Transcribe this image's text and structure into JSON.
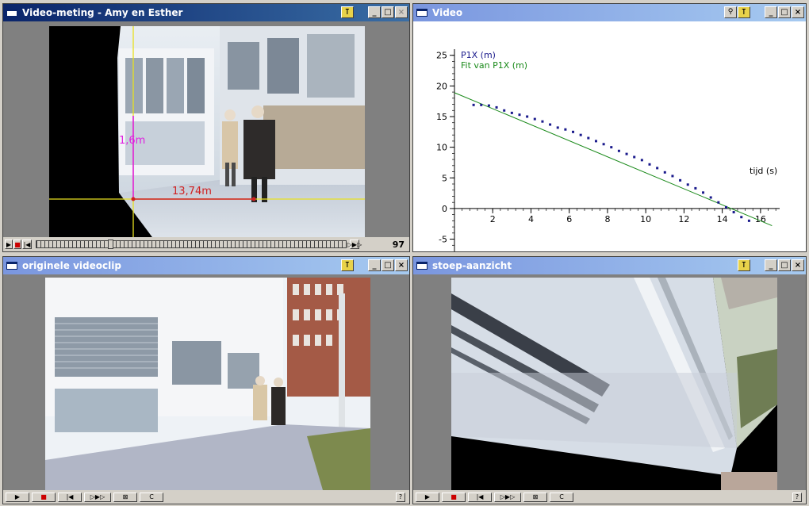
{
  "windows": {
    "measure": {
      "title": "Video-meting - Amy en Esther",
      "frame": "97",
      "label_height": "1,6m",
      "label_distance": "13,74m"
    },
    "graph": {
      "title": "Video"
    },
    "original": {
      "title": "originele videoclip"
    },
    "sidewalk": {
      "title": "stoep-aanzicht"
    }
  },
  "title_buttons": {
    "minimize": "_",
    "maximize": "□",
    "close": "×",
    "pin": "⊺",
    "zoom": "🔍"
  },
  "playback": {
    "play": "▶",
    "stop": "■",
    "first": "|◀",
    "step": "▷▶▷",
    "mark": "⊠",
    "loop": "C",
    "help": "?"
  },
  "colors": {
    "accent_title": "#0a246a",
    "series_points": "#1a1a8c",
    "fit_line": "#1a8a1a",
    "measure_magenta": "#e020e0",
    "measure_red": "#d02020",
    "axis_yellow": "#e8e020"
  },
  "chart_data": {
    "type": "scatter",
    "xlabel": "tijd (s)",
    "ylabel": "",
    "xlim": [
      0,
      17
    ],
    "ylim": [
      -7,
      26
    ],
    "x_ticks": [
      2,
      4,
      6,
      8,
      10,
      12,
      14,
      16
    ],
    "y_ticks": [
      -5,
      0,
      5,
      10,
      15,
      20,
      25
    ],
    "legend_position": "top-left",
    "series": [
      {
        "name": "P1X (m)",
        "color": "#1a1a8c",
        "x": [
          1.0,
          1.4,
          1.8,
          2.2,
          2.6,
          3.0,
          3.4,
          3.8,
          4.2,
          4.6,
          5.0,
          5.4,
          5.8,
          6.2,
          6.6,
          7.0,
          7.4,
          7.8,
          8.2,
          8.6,
          9.0,
          9.4,
          9.8,
          10.2,
          10.6,
          11.0,
          11.4,
          11.8,
          12.2,
          12.6,
          13.0,
          13.4,
          13.8,
          14.2,
          14.6,
          15.0,
          15.4
        ],
        "y": [
          16.9,
          16.9,
          16.8,
          16.5,
          16.0,
          15.6,
          15.3,
          15.0,
          14.6,
          14.2,
          13.7,
          13.2,
          12.9,
          12.5,
          12.0,
          11.5,
          11.0,
          10.5,
          10.0,
          9.4,
          8.9,
          8.4,
          7.9,
          7.2,
          6.6,
          5.9,
          5.3,
          4.6,
          3.9,
          3.3,
          2.6,
          1.8,
          1.0,
          0.2,
          -0.6,
          -1.4,
          -2.0
        ]
      },
      {
        "name": "Fit van P1X (m)",
        "color": "#1a8a1a",
        "type": "line",
        "x": [
          0,
          16.6
        ],
        "y": [
          18.9,
          -2.8
        ]
      }
    ]
  }
}
